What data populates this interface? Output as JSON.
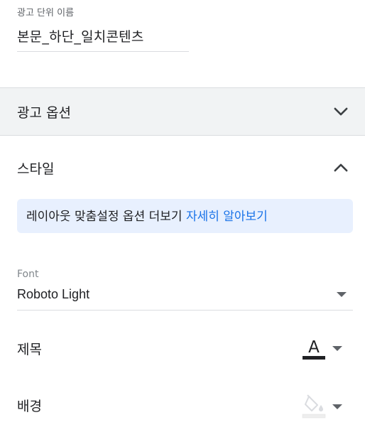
{
  "ad_unit": {
    "label": "광고 단위 이름",
    "value": "본문_하단_일치콘텐츠"
  },
  "sections": {
    "ad_options": {
      "title": "광고 옵션",
      "state": "collapsed",
      "icon": "chevron-down-icon"
    },
    "style": {
      "title": "스타일",
      "state": "expanded",
      "icon": "chevron-up-icon"
    }
  },
  "info": {
    "text": "레이아웃 맞춤설정 옵션 더보기 ",
    "link": "자세히 알아보기"
  },
  "font": {
    "label": "Font",
    "value": "Roboto Light"
  },
  "title_row": {
    "label": "제목",
    "icon": "text-color-icon",
    "glyph": "A",
    "color": "#202124"
  },
  "background_row": {
    "label": "배경",
    "icon": "fill-color-icon",
    "color": "#ffffff"
  },
  "colors": {
    "link": "#1a73e8",
    "info_bg": "#e8f0fe",
    "collapsed_bg": "#f1f3f4"
  }
}
